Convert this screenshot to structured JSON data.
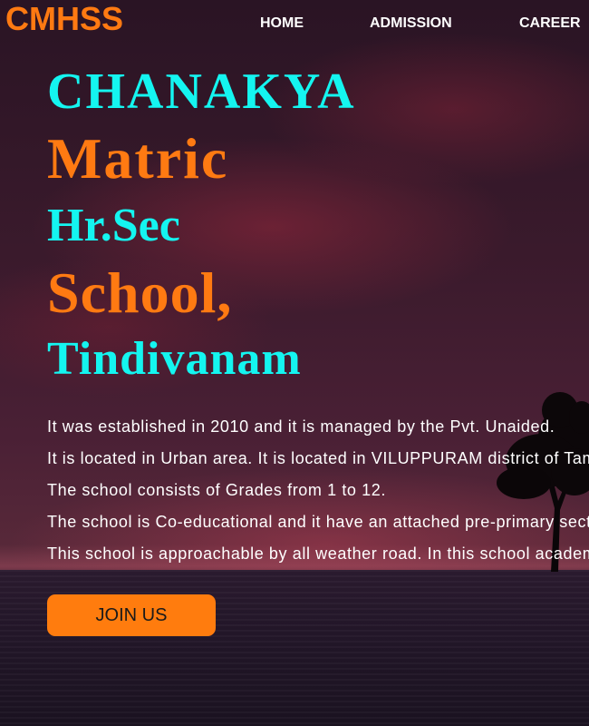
{
  "navbar": {
    "logo": "CMHSS",
    "links": [
      "HOME",
      "ADMISSION",
      "CAREER"
    ]
  },
  "hero": {
    "title_lines": [
      "CHANAKYA",
      "Matric",
      "Hr.Sec",
      "School,",
      "Tindivanam"
    ],
    "description_lines": [
      "It was established in 2010 and it is managed by the Pvt. Unaided.",
      "It is located in Urban area. It is located in VILUPPURAM district of Tamil Nadu.",
      "The school consists of Grades from 1 to 12.",
      "The school is Co-educational and it have an attached pre-primary section.",
      "This school is approachable by all weather road. In this school academic session starts in June."
    ],
    "join_button_label": "JOIN US"
  },
  "colors": {
    "accent_orange": "#ff7a12",
    "accent_cyan": "#14f5f0",
    "nav_text": "#ffffff"
  }
}
